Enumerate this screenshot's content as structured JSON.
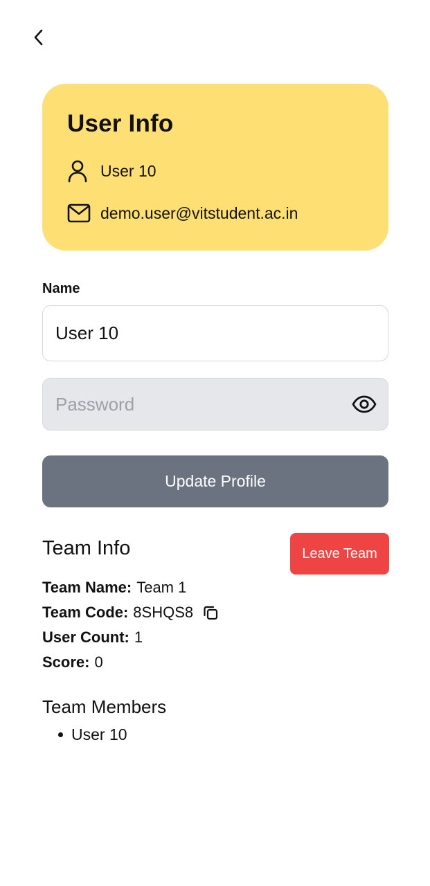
{
  "header": {
    "back_icon": "chevron-left-icon"
  },
  "user_card": {
    "title": "User Info",
    "username": "User 10",
    "email": "demo.user@vitstudent.ac.in",
    "user_icon": "user-icon",
    "email_icon": "mail-icon",
    "background_color": "#fedf74"
  },
  "form": {
    "name_label": "Name",
    "name_value": "User 10",
    "password_placeholder": "Password",
    "password_value": "",
    "eye_icon": "eye-icon",
    "update_button": "Update Profile",
    "update_button_color": "#6b7280"
  },
  "team": {
    "heading": "Team Info",
    "leave_button": "Leave Team",
    "leave_button_color": "#ef4444",
    "name_key": "Team Name:",
    "name_value": "Team 1",
    "code_key": "Team Code:",
    "code_value": "8SHQS8",
    "copy_icon": "copy-icon",
    "count_key": "User Count:",
    "count_value": "1",
    "score_key": "Score:",
    "score_value": "0"
  },
  "members": {
    "heading": "Team Members",
    "items": [
      "User 10"
    ]
  }
}
